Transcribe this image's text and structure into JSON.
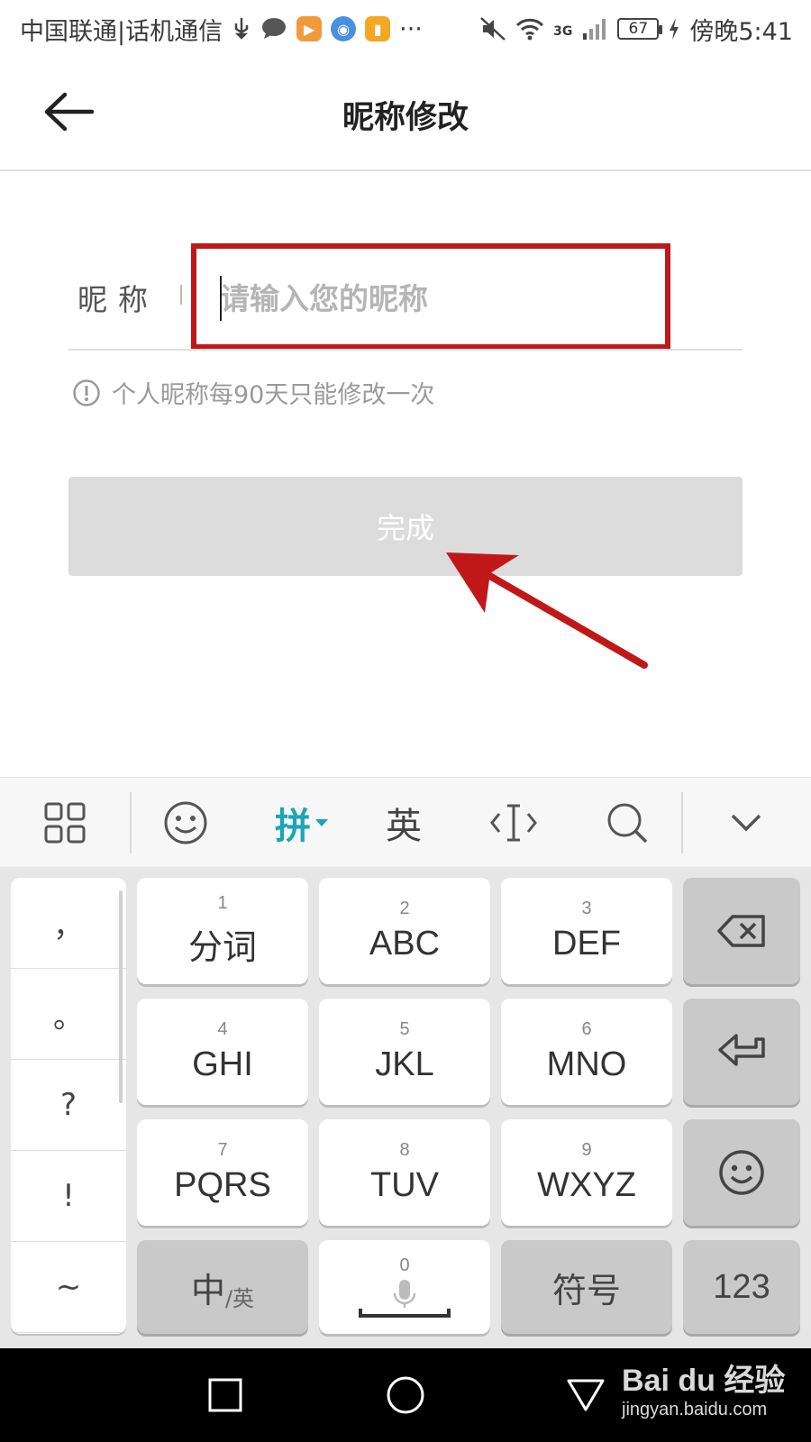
{
  "status_bar": {
    "carrier": "中国联通|话机通信",
    "more": "···",
    "network": "3G",
    "battery": "67",
    "time": "傍晚5:41"
  },
  "header": {
    "title": "昵称修改",
    "back_icon": "arrow-left-icon"
  },
  "form": {
    "label": "昵称",
    "placeholder": "请输入您的昵称",
    "value": "",
    "hint": "个人昵称每90天只能修改一次",
    "hint_icon": "info-icon",
    "done_label": "完成"
  },
  "annotation": {
    "box_color": "#c01818",
    "arrow_color": "#c01818"
  },
  "keyboard_toolbar": {
    "pinyin_label": "拼",
    "english_label": "英",
    "accent_color": "#1aa6b7",
    "icons": [
      "grid-icon",
      "emoji-icon",
      "cursor-icon",
      "search-icon",
      "chevron-down-icon"
    ]
  },
  "keyboard": {
    "punctuation": [
      "，",
      "。",
      "?",
      "!",
      "~"
    ],
    "keys": [
      {
        "num": "1",
        "label": "分词"
      },
      {
        "num": "2",
        "label": "ABC"
      },
      {
        "num": "3",
        "label": "DEF"
      },
      {
        "num": "4",
        "label": "GHI"
      },
      {
        "num": "5",
        "label": "JKL"
      },
      {
        "num": "6",
        "label": "MNO"
      },
      {
        "num": "7",
        "label": "PQRS"
      },
      {
        "num": "8",
        "label": "TUV"
      },
      {
        "num": "9",
        "label": "WXYZ"
      }
    ],
    "bottom": {
      "zh_big": "中",
      "zh_small": "/英",
      "space_num": "0",
      "symbols": "符号",
      "numbers": "123"
    }
  },
  "watermark": {
    "brand": "Bai du 经验",
    "url": "jingyan.baidu.com"
  }
}
